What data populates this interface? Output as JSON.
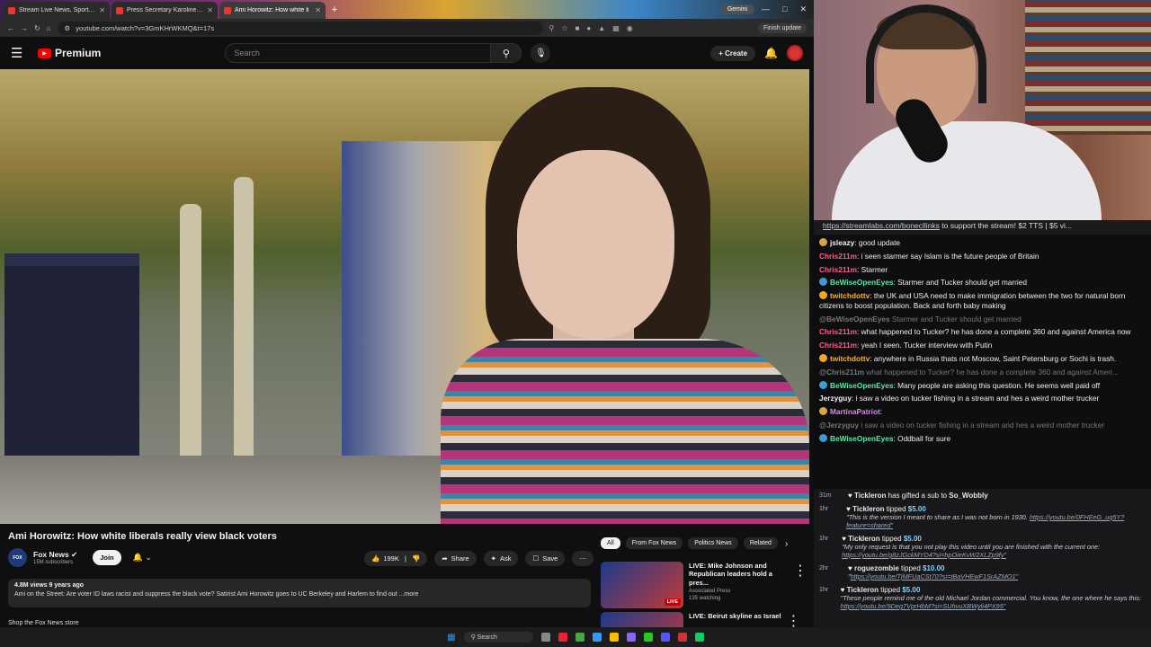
{
  "browser": {
    "tabs": [
      {
        "title": "Stream Live News, Sports, and",
        "color": "#e33"
      },
      {
        "title": "Press Secretary Karoline Le",
        "color": "#e33"
      },
      {
        "title": "Ami Horowitz: How white li",
        "color": "#e33",
        "active": true
      }
    ],
    "gemini": "Gemini",
    "url": "youtube.com/watch?v=3GmKHrWKMQ&t=17s",
    "finish_update": "Finish update"
  },
  "youtube": {
    "logo": "Premium",
    "search_placeholder": "Search",
    "create": "Create",
    "video_title": "Ami Horowitz: How white liberals really view black voters",
    "channel": "Fox News",
    "subscribers": "15M subscribers",
    "join": "Join",
    "likes": "199K",
    "share": "Share",
    "ask": "Ask",
    "save": "Save",
    "more": "⋯",
    "views": "4.8M views  9 years ago",
    "description": "Ami on the Street: Are voter ID laws racist and suppress the black vote? Satirist Ami Horowitz goes to UC Berkeley and Harlem to find out ...more",
    "shop": "Shop the Fox News store",
    "chips": [
      "All",
      "From Fox News",
      "Politics News",
      "Related"
    ],
    "recs": [
      {
        "title": "LIVE: Mike Johnson and Republican leaders hold a pres...",
        "channel": "Associated Press",
        "meta": "135 watching",
        "badge": "LIVE"
      },
      {
        "title": "LIVE: Beirut skyline as Israel",
        "channel": "",
        "meta": "",
        "badge": ""
      }
    ]
  },
  "stream": {
    "promo_link": "https://streamlabs.com/bonecllinks",
    "promo_text": " to support the stream! $2 TTS | $5 vi..."
  },
  "chat": [
    {
      "user": "jsleazy",
      "color": "#f0f0f0",
      "icon": "#d9a441",
      "text": "good update"
    },
    {
      "user": "Chris211m",
      "color": "#ff5c8a",
      "icon": "",
      "text": "i seen starmer say Islam is the future people of Britain"
    },
    {
      "user": "Chris211m",
      "color": "#ff5c8a",
      "icon": "",
      "text": "Starmer"
    },
    {
      "user": "BeWiseOpenEyes",
      "color": "#5ee8a8",
      "icon": "#3f9ad6",
      "text": "Starmer and Tucker should get married"
    },
    {
      "user": "twitchdottv",
      "color": "#ffb02e",
      "icon": "#f5a623",
      "text": "the UK and USA need to make immigration between the two for natural born citizens to boost population. Back and forth baby making"
    },
    {
      "user": "@BeWiseOpenEyes",
      "color": "#777",
      "icon": "",
      "text": "Starmer and Tucker should get married",
      "faded": true
    },
    {
      "user": "Chris211m",
      "color": "#ff5c8a",
      "icon": "",
      "text": "what happened to Tucker? he has done a complete 360 and against America now"
    },
    {
      "user": "Chris211m",
      "color": "#ff5c8a",
      "icon": "",
      "text": "yeah I seen. Tucker interview with Putin"
    },
    {
      "user": "twitchdottv",
      "color": "#ffb02e",
      "icon": "#f5a623",
      "text": "anywhere in Russia thats not Moscow, Saint Petersburg or Sochi is trash."
    },
    {
      "user": "@Chris211m",
      "color": "#777",
      "icon": "",
      "text": "what happened to Tucker? he has done a complete 360 and against Ameri...",
      "faded": true
    },
    {
      "user": "BeWiseOpenEyes",
      "color": "#5ee8a8",
      "icon": "#3f9ad6",
      "text": "Many people are asking this question. He seems well paid off"
    },
    {
      "user": "Jerzyguy",
      "color": "#f0f0f0",
      "icon": "",
      "text": "i saw a video on tucker fishing in a stream and hes a weird mother trucker"
    },
    {
      "user": "MartinaPatriot",
      "color": "#d98ee6",
      "icon": "#d9a441",
      "text": ""
    },
    {
      "user": "@Jerzyguy",
      "color": "#777",
      "icon": "",
      "text": "i saw a video on tucker fishing in a stream and hes a weird mother trucker",
      "faded": true
    },
    {
      "user": "BeWiseOpenEyes",
      "color": "#5ee8a8",
      "icon": "#3f9ad6",
      "text": "Oddball for sure"
    }
  ],
  "tips": [
    {
      "time": "31m",
      "name": "Tickleron",
      "action": " has gifted a sub to ",
      "target": "So_Wobbly",
      "amount": "",
      "msg": "",
      "link": ""
    },
    {
      "time": "1hr",
      "name": "Tickleron",
      "action": " tipped ",
      "target": "",
      "amount": "$5.00",
      "msg": "\"This is the version I meant to share as I was not born in 1930. ",
      "link": "https://youtu.be/0FHEeG_uq5Y?feature=shared\""
    },
    {
      "time": "1hr",
      "name": "Tickleron",
      "action": " tipped ",
      "target": "",
      "amount": "$5.00",
      "msg": "\"My only request is that you not play this video until you are finished with the current one: ",
      "link": "https://youtu.be/g8zJGckMYD4?si=hpOieKvW2XLZp9fy\""
    },
    {
      "time": "2hr",
      "name": "roguezombie",
      "action": " tipped ",
      "target": "",
      "amount": "$10.00",
      "msg": "\"",
      "link": "https://youtu.be/TjMFUaCSt70?si=tBaVHEwF1SrAZMO1\""
    },
    {
      "time": "1hr",
      "name": "Tickleron",
      "action": " tipped ",
      "target": "",
      "amount": "$5.00",
      "msg": "\"These people remind me of the old Michael Jordan commercial. You know, the one where he says this: ",
      "link": "https://youtu.be/9Deg7VprHbM?si=SUhvuXBWyli4PX95\""
    }
  ],
  "taskbar": {
    "search": "Search"
  }
}
